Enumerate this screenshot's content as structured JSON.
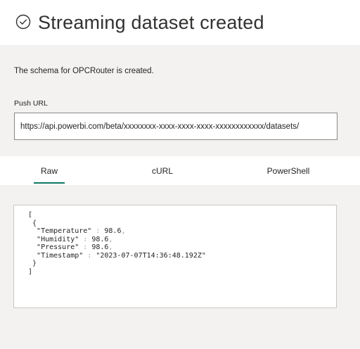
{
  "header": {
    "title": "Streaming dataset created",
    "icon": "check-circle-icon"
  },
  "schema_message": "The schema for OPCRouter is created.",
  "push_url": {
    "label": "Push URL",
    "value": "https://api.powerbi.com/beta/xxxxxxxx-xxxx-xxxx-xxxx-xxxxxxxxxxxx/datasets/"
  },
  "tabs": [
    {
      "label": "Raw",
      "active": true
    },
    {
      "label": "cURL",
      "active": false
    },
    {
      "label": "PowerShell",
      "active": false
    }
  ],
  "code": {
    "open_bracket": "[",
    "open_brace": "{",
    "lines": [
      {
        "key": "\"Temperature\"",
        "sep": " : ",
        "value": "98.6",
        "trail": ","
      },
      {
        "key": "\"Humidity\"",
        "sep": " : ",
        "value": "98.6",
        "trail": ","
      },
      {
        "key": "\"Pressure\"",
        "sep": " : ",
        "value": "98.6",
        "trail": ","
      },
      {
        "key": "\"Timestamp\"",
        "sep": " : ",
        "value": "\"2023-07-07T14:36:48.192Z\"",
        "trail": ""
      }
    ],
    "close_brace": "}",
    "close_bracket": "]"
  },
  "colors": {
    "accent": "#117865",
    "page_background": "#f3f2f1",
    "panel_background": "#ffffff"
  }
}
